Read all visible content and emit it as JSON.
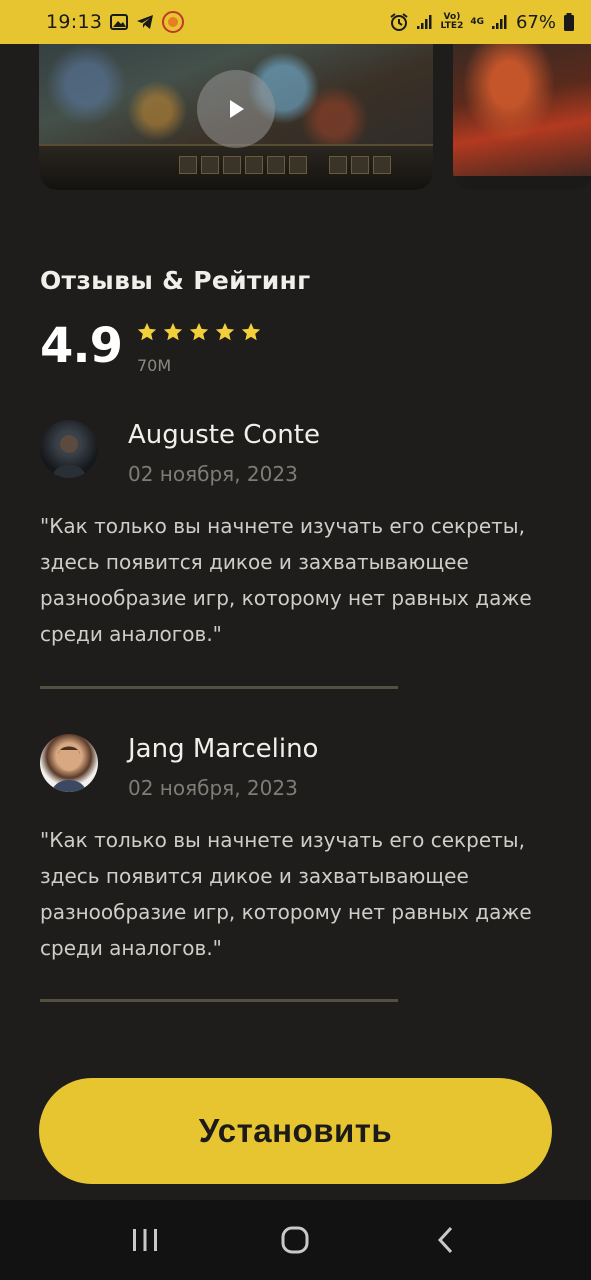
{
  "status_bar": {
    "time": "19:13",
    "battery_percent": "67%",
    "net_label_top": "Vo)",
    "net_label_bottom": "LTE2",
    "net_type": "4G",
    "left_icons": [
      "image-icon",
      "telegram-icon",
      "app-notification-icon"
    ],
    "right_icons": [
      "alarm-icon",
      "signal-icon",
      "signal-icon",
      "battery-icon"
    ],
    "background_color": "#e6c531"
  },
  "media": {
    "screenshots": [
      "screenshot-1",
      "screenshot-2"
    ],
    "play_icon": "play-icon"
  },
  "reviews_section": {
    "title": "Отзывы & Рейтинг",
    "rating": "4.9",
    "rating_stars": 5,
    "rating_count": "70M"
  },
  "reviews": [
    {
      "name": "Auguste Conte",
      "date": "02 ноября, 2023",
      "text": "\"Как только вы начнете изучать его секреты, здесь появится дикое и захватывающее разнообразие игр, которому нет равных даже среди аналогов.\""
    },
    {
      "name": "Jang Marcelino",
      "date": "02 ноября, 2023",
      "text": "\"Как только вы начнете изучать его секреты, здесь появится дикое и захватывающее разнообразие игр, которому нет равных даже среди аналогов.\""
    }
  ],
  "install_button": {
    "label": "Установить",
    "color": "#e6c531"
  },
  "nav_bar": {
    "items": [
      "recent-apps-icon",
      "home-icon",
      "back-icon"
    ]
  },
  "colors": {
    "background": "#1e1d1b",
    "accent": "#e6c531",
    "star": "#f3cf3a",
    "divider": "#54503f"
  }
}
